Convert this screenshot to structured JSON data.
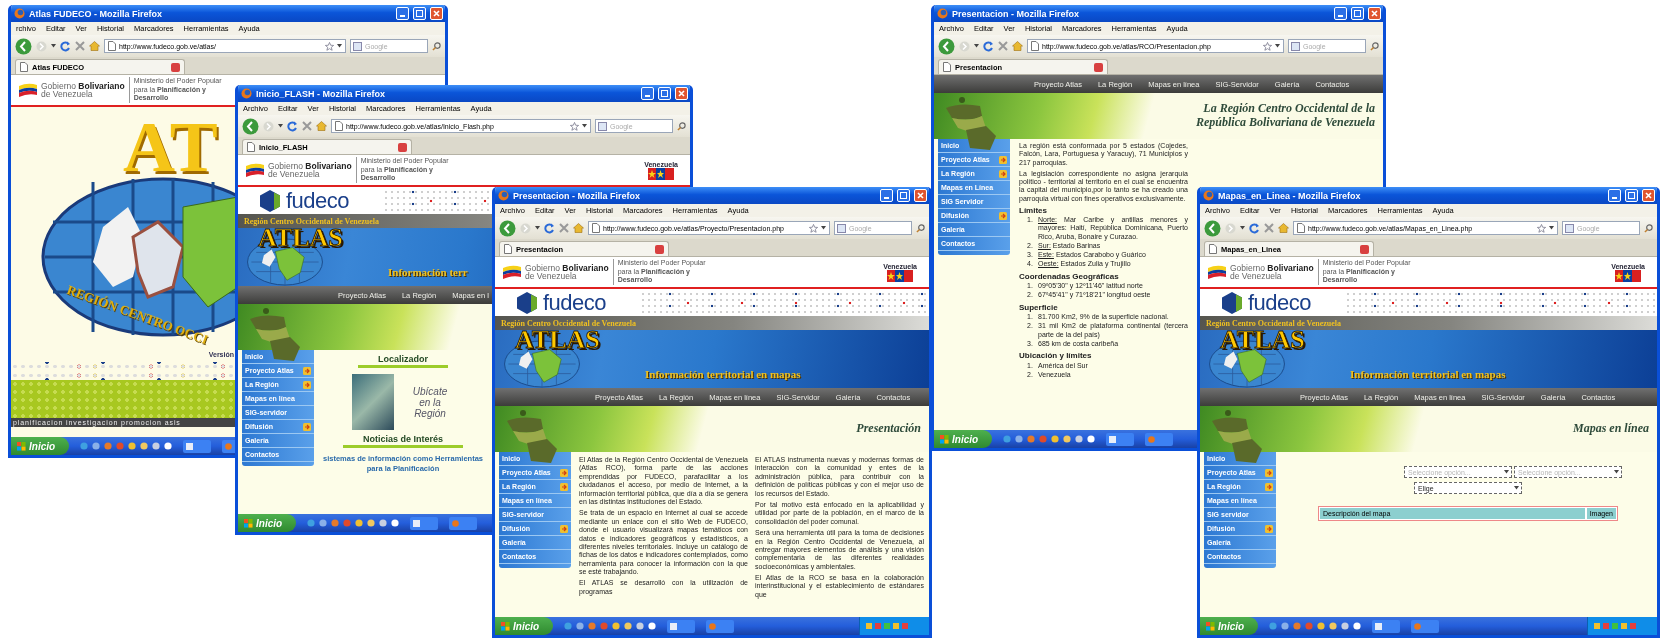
{
  "windows": [
    {
      "title": "Atlas FUDECO - Mozilla Firefox",
      "menu": [
        "rchivo",
        "Editar",
        "Ver",
        "Historial",
        "Marcadores",
        "Herramientas",
        "Ayuda"
      ],
      "url": "http://www.fudeco.gob.ve/atlas/",
      "search_placeholder": "Google",
      "tab": "Atlas FUDECO",
      "start_button": "Inicio",
      "page": {
        "kind": "splash",
        "gov": {
          "name": "Gobierno **Bolivariano**",
          "subname": "de Venezuela",
          "ministry": "Ministerio del Poder Popular para la **Planificación y Desarrollo**"
        },
        "logo": "AT",
        "arc_text": "REGIÓN CENTRO OCCI",
        "version": "Versión",
        "tagline": "planificacion investigacion promocion asis"
      }
    },
    {
      "title": "Inicio_FLASH - Mozilla Firefox",
      "menu": [
        "Archivo",
        "Editar",
        "Ver",
        "Historial",
        "Marcadores",
        "Herramientas",
        "Ayuda"
      ],
      "url": "http://www.fudeco.gob.ve/atlas/Inicio_Flash.php",
      "search_placeholder": "Google",
      "tab": "Inicio_FLASH",
      "start_button": "Inicio",
      "page": {
        "kind": "site",
        "gov": {
          "name": "Gobierno **Bolivariano**",
          "subname": "de Venezuela",
          "ministry": "Ministerio del Poder Popular para la **Planificación y Desarrollo**",
          "badge": "Venezuela"
        },
        "brand": "fudeco",
        "region_label": "Región Centro Occidental de Venezuela",
        "logo": "ATLAS",
        "banner_text": "Información terr",
        "nav": [
          "Proyecto Atlas",
          "La Región",
          "Mapas en l"
        ],
        "sidebar": [
          {
            "label": "Inicio",
            "has_submenu": false
          },
          {
            "label": "Proyecto Atlas",
            "has_submenu": true
          },
          {
            "label": "La Región",
            "has_submenu": true
          },
          {
            "label": "Mapas en línea",
            "has_submenu": false
          },
          {
            "label": "SIG-servidor",
            "has_submenu": false
          },
          {
            "label": "Difusión",
            "has_submenu": true
          },
          {
            "label": "Galería",
            "has_submenu": false
          },
          {
            "label": "Contactos",
            "has_submenu": false
          }
        ],
        "main": {
          "kind": "flash_home",
          "locator_title": "Localizador",
          "locator_caption": "Ubícate en la Región",
          "news_title": "Noticias de Interés",
          "news_text": "sistemas de información como Herramientas para la Planificación"
        }
      }
    },
    {
      "title": "Presentacion - Mozilla Firefox",
      "menu": [
        "Archivo",
        "Editar",
        "Ver",
        "Historial",
        "Marcadores",
        "Herramientas",
        "Ayuda"
      ],
      "url": "http://www.fudeco.gob.ve/atlas/Proyecto/Presentacion.php",
      "search_placeholder": "Google",
      "tab": "Presentacion",
      "start_button": "Inicio",
      "page": {
        "kind": "site",
        "gov": {
          "name": "Gobierno **Bolivariano**",
          "subname": "de Venezuela",
          "ministry": "Ministerio del Poder Popular para la **Planificación y Desarrollo**",
          "badge": "Venezuela"
        },
        "brand": "fudeco",
        "region_label": "Región Centro Occidental de Venezuela",
        "logo": "ATLAS",
        "banner_text": "Información territorial en mapas",
        "nav": [
          "Proyecto Atlas",
          "La Región",
          "Mapas en línea",
          "SIG-Servidor",
          "Galería",
          "Contactos"
        ],
        "heading": "Presentación",
        "sidebar": [
          {
            "label": "Inicio",
            "has_submenu": false
          },
          {
            "label": "Proyecto Atlas",
            "has_submenu": true
          },
          {
            "label": "La Región",
            "has_submenu": true
          },
          {
            "label": "Mapas en línea",
            "has_submenu": false
          },
          {
            "label": "SIG-servidor",
            "has_submenu": false
          },
          {
            "label": "Difusión",
            "has_submenu": true
          },
          {
            "label": "Galería",
            "has_submenu": false
          },
          {
            "label": "Contactos",
            "has_submenu": false
          }
        ],
        "main": {
          "kind": "presentation",
          "columns": [
            [
              "El Atlas de la Región Centro Occidental de Venezuela (Atlas RCO), forma parte de las acciones emprendidas por FUDECO, parafacilitar a los ciudadanos el acceso, por medio de Internet, a la información territorial pública, que día a día se genera en las distintas instituciones del Estado.",
              "Se trata de un espacio en Internet al cual se accede mediante un enlace con el sitio Web de FUDECO, donde el usuario visualizará mapas temáticos con datos e indicadores geográficos y estadísticos, a diferentes niveles territoriales. Incluye un catálogo de fichas de los datos e indicadores contemplados, como herramienta para conocer la información con la que se esté trabajando.",
              "El ATLAS se desarrolló con la utilización de programas"
            ],
            [
              "El ATLAS instrumenta nuevas y modernas formas de interacción con la comunidad y entes de la administración pública, para contribuir con la definición de políticas públicas y con el mejor uso de los recursos del Estado.",
              "Por tal motivo está enfocado en la aplicabilidad y utilidad por parte de la población, en el marco de la consolidación del poder comunal.",
              "Será una herramienta útil para la toma de decisiones en la Región Centro Occidental de Venezuela, al entregar mayores elementos de análisis y una visión complementaria de las diferentes realidades socioeconómicas y ambientales.",
              "El Atlas de la RCO se basa en la colaboración interinstitucional y el establecimiento de estándares que"
            ]
          ]
        }
      }
    },
    {
      "title": "Presentacion - Mozilla Firefox",
      "menu": [
        "Archivo",
        "Editar",
        "Ver",
        "Historial",
        "Marcadores",
        "Herramientas",
        "Ayuda"
      ],
      "url": "http://www.fudeco.gob.ve/atlas/RCO/Presentacion.php",
      "search_placeholder": "Google",
      "tab": "Presentacion",
      "start_button": "Inicio",
      "page": {
        "kind": "site",
        "nav": [
          "Proyecto Atlas",
          "La Región",
          "Mapas en línea",
          "SIG-Servidor",
          "Galería",
          "Contactos"
        ],
        "heading": "La Región Centro Occidental de la República Bolivariana de Venezuela",
        "sidebar": [
          {
            "label": "Inicio",
            "has_submenu": false
          },
          {
            "label": "Proyecto Atlas",
            "has_submenu": true
          },
          {
            "label": "La Región",
            "has_submenu": true
          },
          {
            "label": "Mapas en Línea",
            "has_submenu": false
          },
          {
            "label": "SIG Servidor",
            "has_submenu": false
          },
          {
            "label": "Difusión",
            "has_submenu": true
          },
          {
            "label": "Galería",
            "has_submenu": false
          },
          {
            "label": "Contactos",
            "has_submenu": false
          }
        ],
        "main": {
          "kind": "region",
          "intro": [
            "La región está conformada por 5 estados (Cojedes, Falcón, Lara, Portuguesa y Yaracuy), 71 Municipios y 217 parroquias.",
            "La legislación correspondiente no asigna jerarquía político - territorial al territorio en el cual se encuentra la capital del municipio,por lo tanto se ha creado una parroquia virtual con fines operativos exclusivamente."
          ],
          "sections": [
            {
              "title": "Límites",
              "items": [
                {
                  "number": "1.",
                  "label": "Norte:",
                  "text": "Mar Caribe y antillas menores y mayores: Haití, República Dominicana, Puerto Rico, Aruba, Bonaire y Curazao."
                },
                {
                  "number": "2.",
                  "label": "Sur:",
                  "text": "Estado Barinas"
                },
                {
                  "number": "3.",
                  "label": "Este:",
                  "text": "Estados Carabobo y Guárico"
                },
                {
                  "number": "4.",
                  "label": "Oeste:",
                  "text": "Estados Zulia y Trujillo"
                }
              ]
            },
            {
              "title": "Coordenadas Geográficas",
              "items": [
                {
                  "number": "1.",
                  "text": "09º05'30\" y 12º11'46\" latitud norte"
                },
                {
                  "number": "2.",
                  "text": "67º45'41\" y 71º18'21\" longitud oeste"
                }
              ]
            },
            {
              "title": "Superficie",
              "items": [
                {
                  "number": "1.",
                  "text": "81.700 Km2, 9% de la superficie nacional."
                },
                {
                  "number": "2.",
                  "text": "31 mil Km2 de plataforma continental (tercera parte de la del país)"
                },
                {
                  "number": "3.",
                  "text": "685 km de costa caribeña"
                }
              ]
            },
            {
              "title": "Ubicación y límites",
              "items": [
                {
                  "number": "1.",
                  "text": "América del Sur"
                },
                {
                  "number": "2.",
                  "text": "Venezuela"
                }
              ]
            }
          ]
        }
      }
    },
    {
      "title": "Mapas_en_Linea - Mozilla Firefox",
      "menu": [
        "Archivo",
        "Editar",
        "Ver",
        "Historial",
        "Marcadores",
        "Herramientas",
        "Ayuda"
      ],
      "url": "http://www.fudeco.gob.ve/atlas/Mapas_en_Linea.php",
      "search_placeholder": "Google",
      "tab": "Mapas_en_Linea",
      "start_button": "Inicio",
      "page": {
        "kind": "site",
        "gov": {
          "name": "Gobierno **Bolivariano**",
          "subname": "de Venezuela",
          "ministry": "Ministerio del Poder Popular para la **Planificación y Desarrollo**",
          "badge": "Venezuela"
        },
        "brand": "fudeco",
        "region_label": "Región Centro Occidental de Venezuela",
        "logo": "ATLAS",
        "banner_text": "Información territorial en mapas",
        "nav": [
          "Proyecto Atlas",
          "La Región",
          "Mapas en línea",
          "SIG-Servidor",
          "Galería",
          "Contactos"
        ],
        "heading": "Mapas en línea",
        "sidebar": [
          {
            "label": "Inicio",
            "has_submenu": false
          },
          {
            "label": "Proyecto Atlas",
            "has_submenu": true
          },
          {
            "label": "La Región",
            "has_submenu": true
          },
          {
            "label": "Mapas en línea",
            "has_submenu": false
          },
          {
            "label": "SIG servidor",
            "has_submenu": false
          },
          {
            "label": "Difusión",
            "has_submenu": true
          },
          {
            "label": "Galería",
            "has_submenu": false
          },
          {
            "label": "Contactos",
            "has_submenu": false
          }
        ],
        "main": {
          "kind": "maps",
          "selects": [
            {
              "value": "Seleccione opción...",
              "disabled": true
            },
            {
              "value": "Seleccione opción...",
              "disabled": true
            }
          ],
          "choice": {
            "value": "Elige",
            "disabled": false
          },
          "table_columns": [
            "Descripción del mapa",
            "Imagen"
          ]
        }
      }
    }
  ]
}
